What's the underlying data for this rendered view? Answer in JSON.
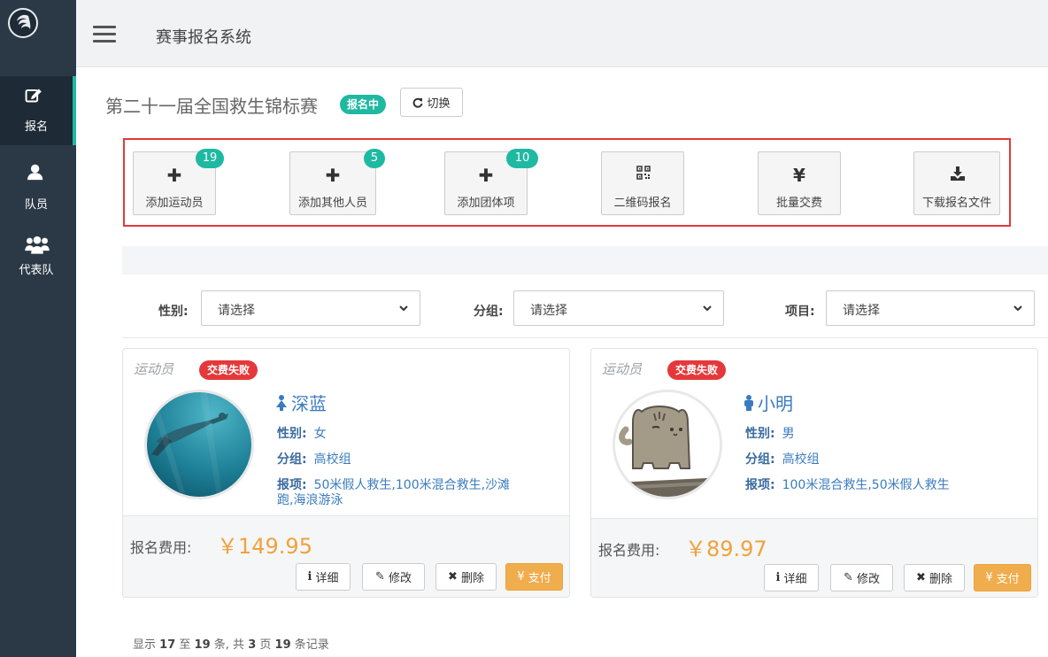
{
  "app": {
    "title": "赛事报名系统"
  },
  "sidebar": {
    "items": [
      {
        "label": "报名",
        "icon": "edit-icon",
        "active": true
      },
      {
        "label": "队员",
        "icon": "user-icon",
        "active": false
      },
      {
        "label": "代表队",
        "icon": "users-icon",
        "active": false
      }
    ]
  },
  "competition": {
    "title": "第二十一届全国救生锦标赛",
    "status": "报名中",
    "switch_label": "切换"
  },
  "actions": [
    {
      "label": "添加运动员",
      "icon": "plus-icon",
      "badge": "19"
    },
    {
      "label": "添加其他人员",
      "icon": "plus-icon",
      "badge": "5"
    },
    {
      "label": "添加团体项",
      "icon": "plus-icon",
      "badge": "10"
    },
    {
      "label": "二维码报名",
      "icon": "qrcode-icon",
      "badge": ""
    },
    {
      "label": "批量交费",
      "icon": "yen-icon",
      "badge": ""
    },
    {
      "label": "下载报名文件",
      "icon": "download-icon",
      "badge": ""
    }
  ],
  "filters": {
    "gender": {
      "label": "性别:",
      "value": "请选择"
    },
    "group": {
      "label": "分组:",
      "value": "请选择"
    },
    "event": {
      "label": "项目:",
      "value": "请选择"
    }
  },
  "cards": [
    {
      "role": "运动员",
      "status": "交费失败",
      "name": "深蓝",
      "gender_label": "性别:",
      "gender": "女",
      "group_label": "分组:",
      "group": "高校组",
      "events_label": "报项:",
      "events_line1": "50米假人救生,100米混合救生,沙滩",
      "events_line2": "跑,海浪游泳",
      "fee_label": "报名费用:",
      "fee": "￥149.95"
    },
    {
      "role": "运动员",
      "status": "交费失败",
      "name": "小明",
      "gender_label": "性别:",
      "gender": "男",
      "group_label": "分组:",
      "group": "高校组",
      "events_label": "报项:",
      "events_line1": "100米混合救生,50米假人救生",
      "events_line2": "",
      "fee_label": "报名费用:",
      "fee": "￥89.97"
    }
  ],
  "card_buttons": {
    "detail": "详细",
    "edit": "修改",
    "delete": "删除",
    "pay": "支付"
  },
  "pager": {
    "prefix": "显示",
    "from": "17",
    "to_word": "至",
    "to": "19",
    "mid": "条, 共",
    "pages": "3",
    "page_word": "页",
    "total": "19",
    "suffix": "条记录"
  },
  "colors": {
    "sidebar": "#2b3947",
    "accent": "#1fb9a2",
    "danger": "#e5383a",
    "price": "#f0a23c",
    "pay": "#f0ad4e"
  }
}
